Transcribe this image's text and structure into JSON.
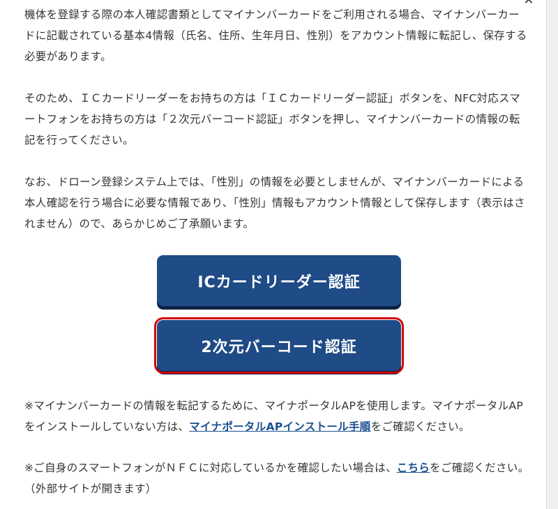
{
  "dialog": {
    "close_glyph": "✕"
  },
  "paragraph1": {
    "text": "機体を登録する際の本人確認書類としてマイナンバーカードをご利用される場合、マイナンバーカードに記載されている基本4情報（氏名、住所、生年月日、性別）をアカウント情報に転記し、保存する必要があります。"
  },
  "paragraph2": {
    "text": "そのため、ＩＣカードリーダーをお持ちの方は「ＩＣカードリーダー認証」ボタンを、NFC対応スマートフォンをお持ちの方は「２次元バーコード認証」ボタンを押し、マイナンバーカードの情報の転記を行ってください。"
  },
  "paragraph3": {
    "text": "なお、ドローン登録システム上では、「性別」の情報を必要としませんが、マイナンバーカードによる本人確認を行う場合に必要な情報であり、「性別」情報もアカウント情報として保存します（表示はされません）ので、あらかじめご了承願います。"
  },
  "buttons": {
    "ic_label": "ICカードリーダー認証",
    "qr_label": "2次元バーコード認証"
  },
  "note1": {
    "before": "※マイナンバーカードの情報を転記するために、マイナポータルAPを使用します。マイナポータルAPをインストールしていない方は、",
    "link": "マイナポータルAPインストール手順",
    "after": "をご確認ください。"
  },
  "note2": {
    "before": "※ご自身のスマートフォンがＮＦＣに対応しているかを確認したい場合は、",
    "link": "こちら",
    "after": "をご確認ください。（外部サイトが開きます）"
  },
  "colors": {
    "button_bg": "#1f4b86",
    "highlight": "#d40000",
    "link": "#1a4f8f"
  }
}
